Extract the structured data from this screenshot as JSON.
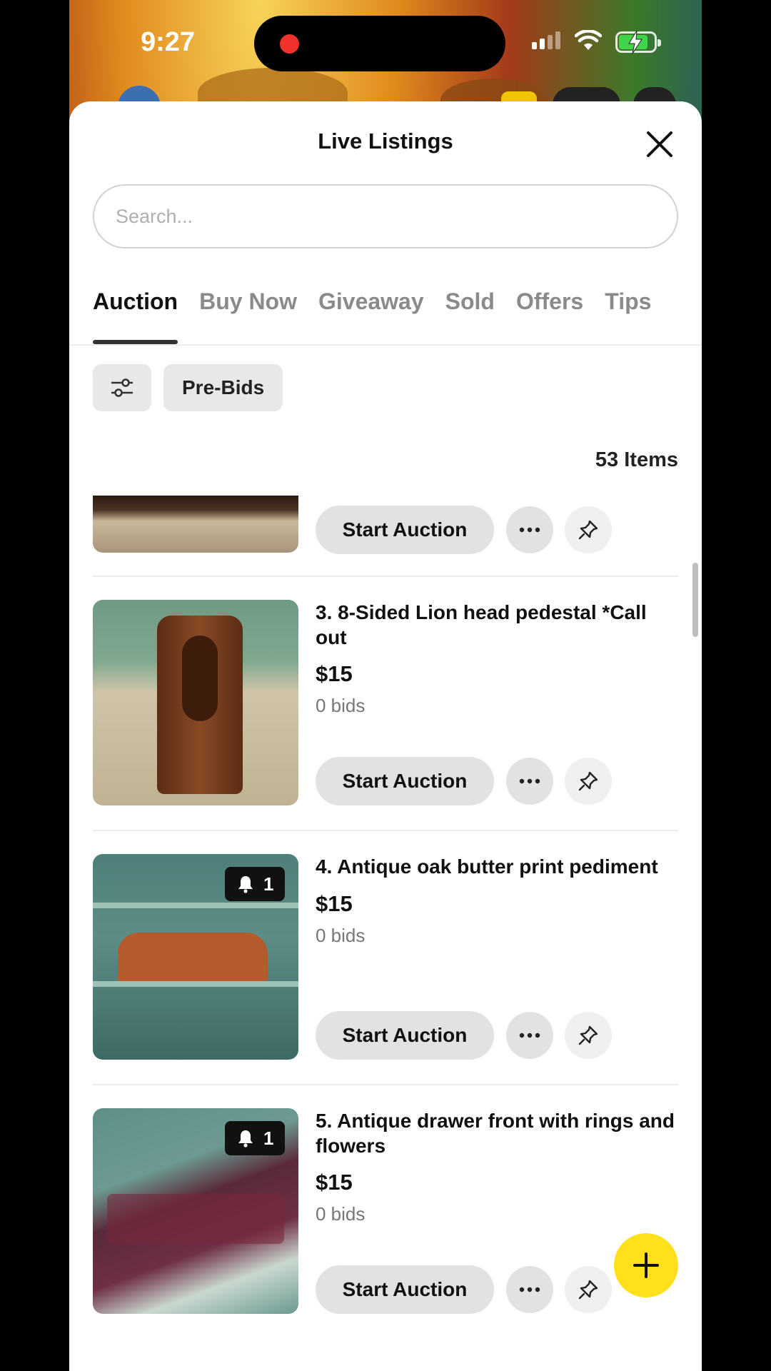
{
  "status_bar": {
    "time": "9:27"
  },
  "sheet": {
    "title": "Live Listings"
  },
  "search": {
    "placeholder": "Search..."
  },
  "tabs": [
    {
      "label": "Auction",
      "active": true
    },
    {
      "label": "Buy Now"
    },
    {
      "label": "Giveaway"
    },
    {
      "label": "Sold"
    },
    {
      "label": "Offers"
    },
    {
      "label": "Tips"
    }
  ],
  "filters": {
    "prebids_label": "Pre-Bids"
  },
  "items_count": "53 Items",
  "actions": {
    "start_auction_label": "Start Auction"
  },
  "listings": [
    {
      "title": "3. 8-Sided Lion head pedestal *Call out",
      "price": "$15",
      "bids": "0 bids"
    },
    {
      "title": "4. Antique oak butter print pediment",
      "price": "$15",
      "bids": "0 bids",
      "watchers": "1"
    },
    {
      "title": "5. Antique drawer front with rings and flowers",
      "price": "$15",
      "bids": "0 bids",
      "watchers": "1"
    }
  ],
  "colors": {
    "fab": "#ffe01a",
    "accent_dark": "#111111",
    "button_bg": "#e2e2e2"
  }
}
